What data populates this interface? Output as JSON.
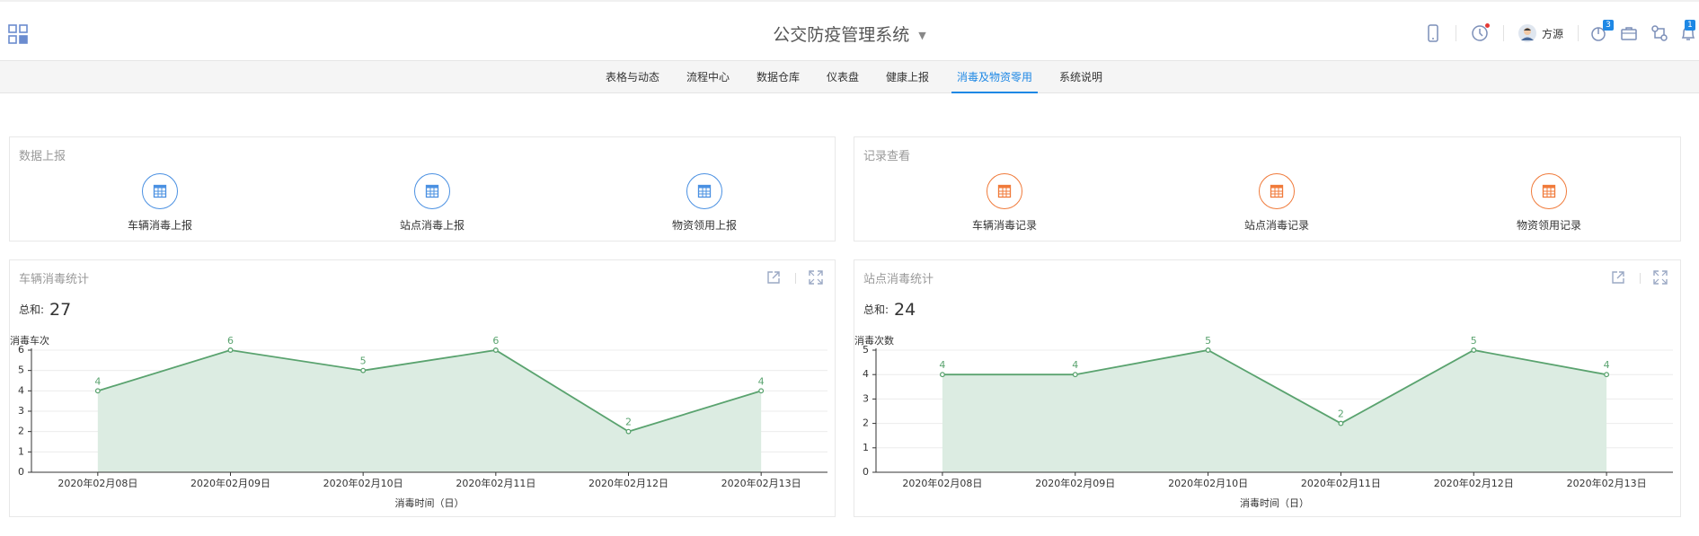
{
  "header": {
    "title": "公交防疫管理系统",
    "user_name": "方源",
    "badge_counts": [
      "3",
      "1"
    ]
  },
  "nav": {
    "items": [
      "表格与动态",
      "流程中心",
      "数据仓库",
      "仪表盘",
      "健康上报",
      "消毒及物资零用",
      "系统说明"
    ],
    "active_index": 5
  },
  "report_panel": {
    "title": "数据上报",
    "tiles": [
      "车辆消毒上报",
      "站点消毒上报",
      "物资领用上报"
    ]
  },
  "records_panel": {
    "title": "记录查看",
    "tiles": [
      "车辆消毒记录",
      "站点消毒记录",
      "物资领用记录"
    ]
  },
  "vehicle_chart": {
    "title": "车辆消毒统计",
    "sum_label": "总和:",
    "sum_value": "27"
  },
  "station_chart": {
    "title": "站点消毒统计",
    "sum_label": "总和:",
    "sum_value": "24"
  },
  "colors": {
    "accent": "#1e88e5",
    "line": "#5aa36f",
    "area": "#dcece2",
    "orange": "#f07a3a"
  },
  "chart_data": [
    {
      "type": "area",
      "categories": [
        "2020年02月08日",
        "2020年02月09日",
        "2020年02月10日",
        "2020年02月11日",
        "2020年02月12日",
        "2020年02月13日"
      ],
      "series": [
        {
          "values": [
            4,
            6,
            5,
            6,
            2,
            4
          ]
        }
      ],
      "xlabel": "消毒时间（日）",
      "ylabel": "消毒车次",
      "ylim": [
        0,
        6
      ],
      "yticks": [
        0,
        1,
        2,
        3,
        4,
        5,
        6
      ],
      "grid": true
    },
    {
      "type": "area",
      "categories": [
        "2020年02月08日",
        "2020年02月09日",
        "2020年02月10日",
        "2020年02月11日",
        "2020年02月12日",
        "2020年02月13日"
      ],
      "series": [
        {
          "values": [
            4,
            4,
            5,
            2,
            5,
            4
          ]
        }
      ],
      "xlabel": "消毒时间（日）",
      "ylabel": "消毒次数",
      "ylim": [
        0,
        5
      ],
      "yticks": [
        0,
        1,
        2,
        3,
        4,
        5
      ],
      "grid": true
    }
  ]
}
